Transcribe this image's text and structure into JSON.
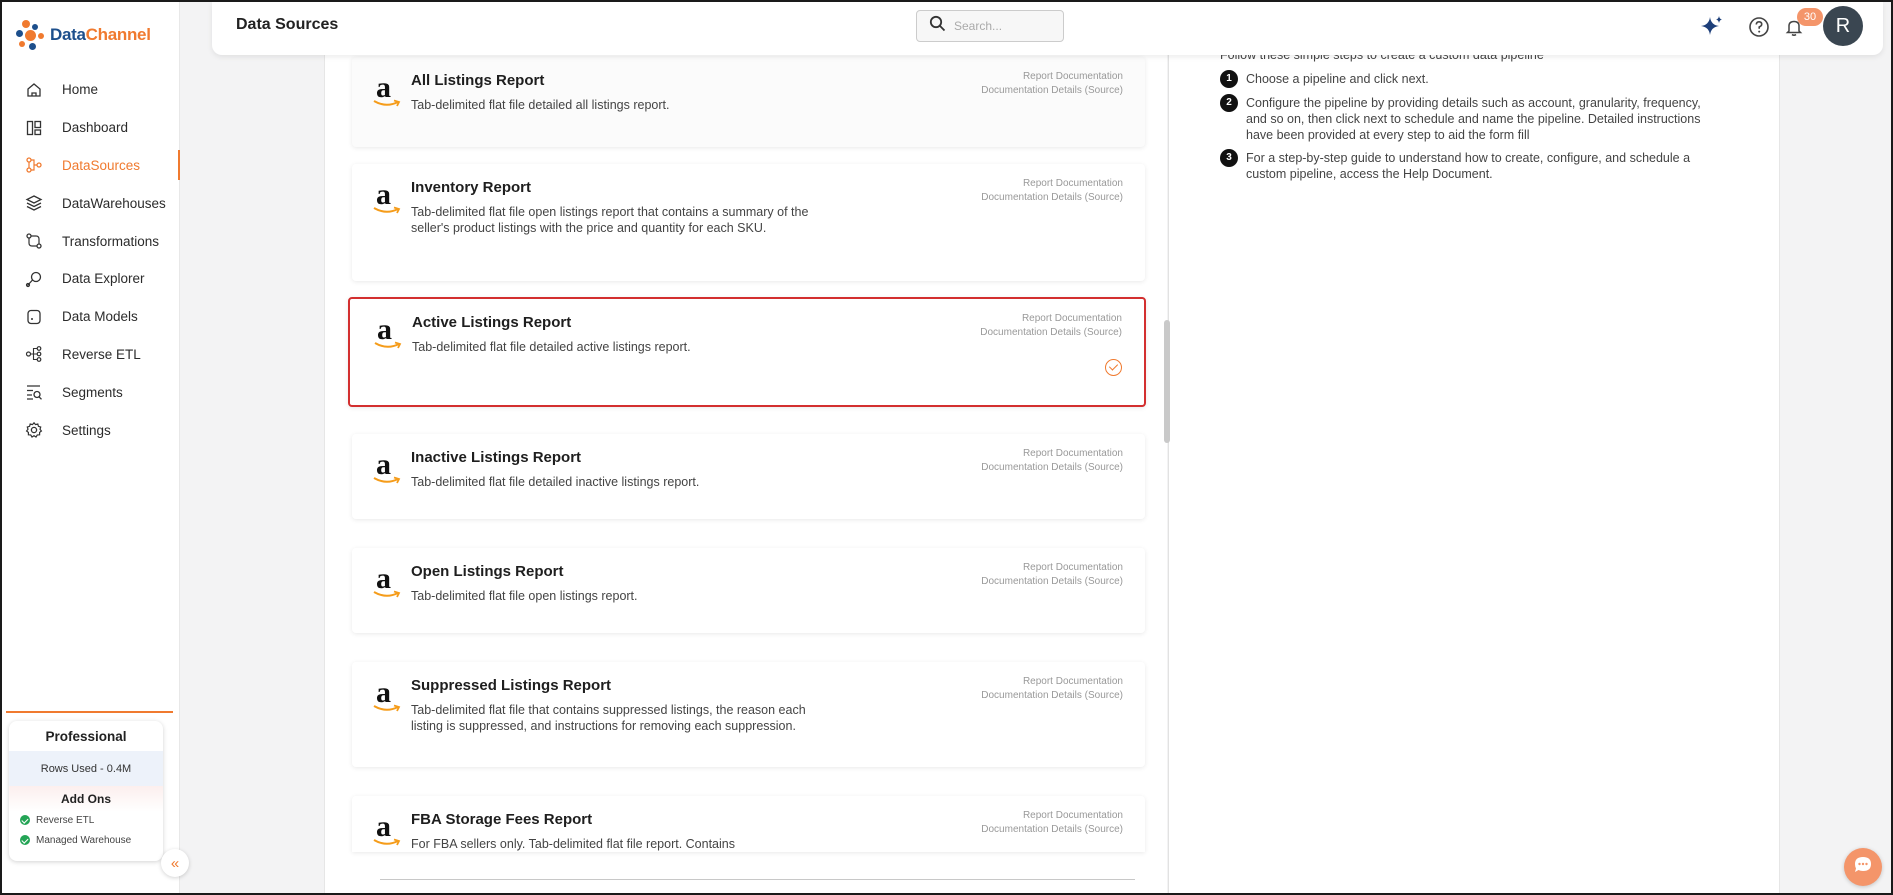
{
  "app": {
    "logo_part1": "Data",
    "logo_part2": "Channel"
  },
  "header": {
    "title": "Data Sources",
    "search_placeholder": "Search...",
    "notification_count": "30",
    "avatar_initial": "R"
  },
  "sidebar": {
    "items": [
      {
        "label": "Home",
        "icon": "home-icon",
        "active": false
      },
      {
        "label": "Dashboard",
        "icon": "dashboard-icon",
        "active": false
      },
      {
        "label": "DataSources",
        "icon": "datasources-icon",
        "active": true
      },
      {
        "label": "DataWarehouses",
        "icon": "layers-icon",
        "active": false
      },
      {
        "label": "Transformations",
        "icon": "transform-icon",
        "active": false
      },
      {
        "label": "Data Explorer",
        "icon": "explorer-icon",
        "active": false
      },
      {
        "label": "Data Models",
        "icon": "database-icon",
        "active": false
      },
      {
        "label": "Reverse ETL",
        "icon": "network-icon",
        "active": false
      },
      {
        "label": "Segments",
        "icon": "segments-icon",
        "active": false
      },
      {
        "label": "Settings",
        "icon": "gear-icon",
        "active": false
      }
    ]
  },
  "plan": {
    "name": "Professional",
    "rows_used": "Rows Used - 0.4M",
    "addons_title": "Add Ons",
    "addons": [
      "Reverse ETL",
      "Managed Warehouse"
    ]
  },
  "reports": [
    {
      "title": "All Listings Report",
      "desc": "Tab-delimited flat file detailed all listings report.",
      "link1": "Report Documentation",
      "link2": "Documentation Details (Source)"
    },
    {
      "title": "Inventory Report",
      "desc": "Tab-delimited flat file open listings report that contains a summary of the seller's product listings with the price and quantity for each SKU.",
      "link1": "Report Documentation",
      "link2": "Documentation Details (Source)"
    },
    {
      "title": "Active Listings Report",
      "desc": "Tab-delimited flat file detailed active listings report.",
      "link1": "Report Documentation",
      "link2": "Documentation Details (Source)",
      "selected": true
    },
    {
      "title": "Inactive Listings Report",
      "desc": "Tab-delimited flat file detailed inactive listings report.",
      "link1": "Report Documentation",
      "link2": "Documentation Details (Source)"
    },
    {
      "title": "Open Listings Report",
      "desc": "Tab-delimited flat file open listings report.",
      "link1": "Report Documentation",
      "link2": "Documentation Details (Source)"
    },
    {
      "title": "Suppressed Listings Report",
      "desc": "Tab-delimited flat file that contains suppressed listings, the reason each listing is suppressed, and instructions for removing each suppression.",
      "link1": "Report Documentation",
      "link2": "Documentation Details (Source)"
    },
    {
      "title": "FBA Storage Fees Report",
      "desc": "For FBA sellers only. Tab-delimited flat file report. Contains",
      "link1": "Report Documentation",
      "link2": "Documentation Details (Source)"
    }
  ],
  "guide": {
    "intro": "Follow these simple steps to create a custom data pipeline",
    "steps": [
      {
        "num": "1",
        "text": "Choose a pipeline and click next."
      },
      {
        "num": "2",
        "text": "Configure the pipeline by providing details such as account, granularity, frequency, and so on, then click next to schedule and name the pipeline. Detailed instructions have been provided at every step to aid the form fill"
      },
      {
        "num": "3",
        "text": "For a step-by-step guide to understand how to create, configure, and schedule a custom pipeline, access the Help Document."
      }
    ]
  },
  "colors": {
    "accent": "#f07a2f",
    "brand_blue": "#1d4f8c",
    "selected_border": "#d32f2f",
    "success": "#23a455"
  }
}
